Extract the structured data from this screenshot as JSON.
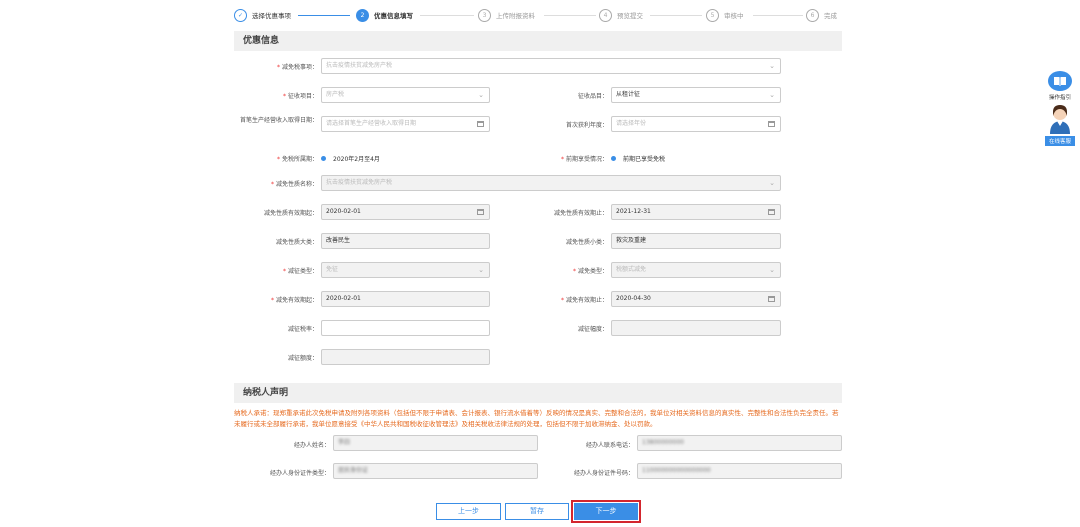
{
  "steps": [
    {
      "num": "✓",
      "label": "选择优惠事项"
    },
    {
      "num": "2",
      "label": "优惠信息填写"
    },
    {
      "num": "3",
      "label": "上传附报资料"
    },
    {
      "num": "4",
      "label": "预览提交"
    },
    {
      "num": "5",
      "label": "审核中"
    },
    {
      "num": "6",
      "label": "完成"
    }
  ],
  "sections": {
    "discount_info": "优惠信息",
    "taxpayer_statement": "纳税人声明"
  },
  "form": {
    "reduction_item": {
      "label": "减免税事项：",
      "placeholder": "抗击疫情扶贫减免房产税"
    },
    "levy_item": {
      "label": "征收项目：",
      "placeholder": "房产税"
    },
    "levy_subitem": {
      "label": "征收品目：",
      "value": "从租计征"
    },
    "first_income_date": {
      "label": "首笔生产经营收入取得日期：",
      "placeholder": "请选择首笔生产经营收入取得日期"
    },
    "first_profit_year": {
      "label": "首次获利年度：",
      "placeholder": "请选择年份"
    },
    "exemption_period": {
      "label": "免税所属期：",
      "value": "2020年2月至4月"
    },
    "prior_enjoy": {
      "label": "前期享受情况：",
      "value": "前期已享受免税"
    },
    "nature_name": {
      "label": "减免性质名称：",
      "placeholder": "抗击疫情扶贫减免房产税"
    },
    "nature_start": {
      "label": "减免性质有效期起：",
      "value": "2020-02-01"
    },
    "nature_end": {
      "label": "减免性质有效期止：",
      "value": "2021-12-31"
    },
    "nature_major": {
      "label": "减免性质大类：",
      "value": "改善民生"
    },
    "nature_minor": {
      "label": "减免性质小类：",
      "value": "救灾及重建"
    },
    "collection_type": {
      "label": "减征类型：",
      "placeholder": "免征"
    },
    "reduction_type": {
      "label": "减免类型：",
      "placeholder": "税额式减免"
    },
    "valid_start": {
      "label": "减免有效期起：",
      "value": "2020-02-01"
    },
    "valid_end": {
      "label": "减免有效期止：",
      "value": "2020-04-30"
    },
    "reduction_rate": {
      "label": "减征税率："
    },
    "reduction_ratio": {
      "label": "减征幅度："
    },
    "reduction_amount": {
      "label": "减征额度："
    }
  },
  "notice_text": "纳税人承诺：现郑重承诺此次免税申请及附列各项资料（包括但不限于申请表、会计报表、银行流水借着等）反映的情况是真实、完整和合法的，我单位对相关资料信息的真实性、完整性和合法性负完全责任。若未履行或未全部履行承诺，我单位愿意接受《中华人民共和国税收征收管理法》及相关税收法律法规的处理，包括但不限于加收滞纳金、处以罚款。",
  "agent": {
    "name_label": "经办人姓名：",
    "name_value": "李四",
    "phone_label": "经办人联系电话：",
    "phone_value": "13800000000",
    "idtype_label": "经办人身份证件类型：",
    "idtype_value": "居民身份证",
    "idno_label": "经办人身份证件号码：",
    "idno_value": "110000000000000000"
  },
  "buttons": {
    "prev": "上一步",
    "save": "暂存",
    "next": "下一步"
  },
  "side": {
    "guide": "操作指引",
    "service": "在线客服"
  },
  "colors": {
    "accent": "#3a8ee6",
    "notice": "#e66a1f",
    "highlight": "#d3262e"
  }
}
